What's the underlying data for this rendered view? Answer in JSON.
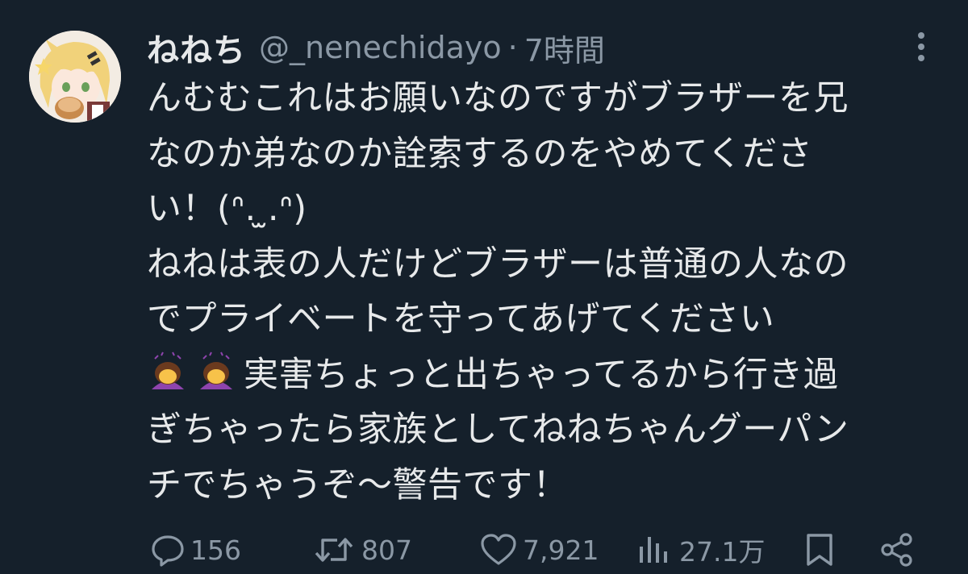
{
  "tweet": {
    "display_name": "ねねち",
    "handle": "@_nenechidayo",
    "separator": "·",
    "time": "7時間",
    "lines": [
      "んむむこれはお願いなのですがブラザーを兄",
      "なのか弟なのか詮索するのをやめてくださ",
      "い！(ᐢ.  ̫.ᐢ)",
      "ねねは表の人だけどブラザーは普通の人なの",
      "でプライベートを守ってあげてください",
      "実害ちょっと出ちゃってるから行き過",
      "ぎちゃったら家族としてねねちゃんグーパン",
      "チでちゃうぞ〜警告です！"
    ]
  },
  "icons": {
    "avatar": "avatar-anime-girl",
    "more": "more-vertical-icon",
    "emoji": "woman-bowing-emoji",
    "reply": "reply-icon",
    "retweet": "retweet-icon",
    "like": "heart-icon",
    "views": "views-icon",
    "bookmark": "bookmark-icon",
    "share": "share-icon"
  },
  "metrics": {
    "replies": "156",
    "retweets": "807",
    "likes": "7,921",
    "views": "27.1万"
  },
  "colors": {
    "background": "#15202b",
    "text": "#e7e9ea",
    "secondary": "#8b98a5"
  }
}
